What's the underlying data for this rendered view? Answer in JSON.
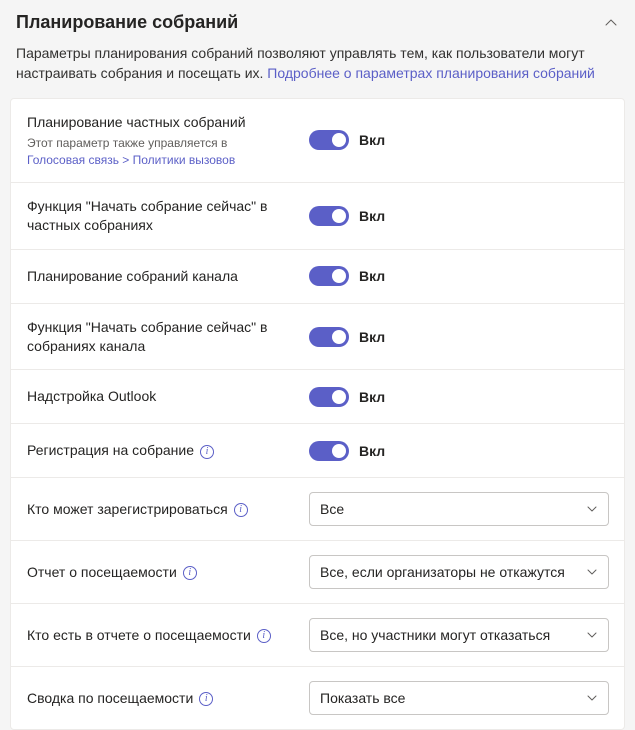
{
  "header": {
    "title": "Планирование собраний"
  },
  "description": {
    "text_prefix": "Параметры планирования собраний позволяют управлять тем, как пользователи могут настраивать собрания и посещать их. ",
    "link_text": "Подробнее о параметрах планирования собраний"
  },
  "toggle_on_label": "Вкл",
  "rows": {
    "private_meeting": {
      "label": "Планирование частных собраний",
      "sub_prefix": "Этот параметр также управляется в",
      "sub_link": "Голосовая связь > Политики вызовов"
    },
    "meet_now_private": {
      "label": "Функция \"Начать собрание сейчас\" в частных собраниях"
    },
    "channel_scheduling": {
      "label": "Планирование собраний канала"
    },
    "meet_now_channel": {
      "label": "Функция \"Начать собрание сейчас\" в собраниях канала"
    },
    "outlook_addin": {
      "label": "Надстройка Outlook"
    },
    "registration": {
      "label": "Регистрация на собрание"
    },
    "who_register": {
      "label": "Кто может зарегистрироваться",
      "value": "Все"
    },
    "attendance_report": {
      "label": "Отчет о посещаемости",
      "value": "Все, если организаторы не откажутся"
    },
    "who_in_report": {
      "label": "Кто есть в отчете о посещаемости",
      "value": "Все, но участники могут отказаться"
    },
    "attendance_summary": {
      "label": "Сводка по посещаемости",
      "value": "Показать все"
    }
  }
}
